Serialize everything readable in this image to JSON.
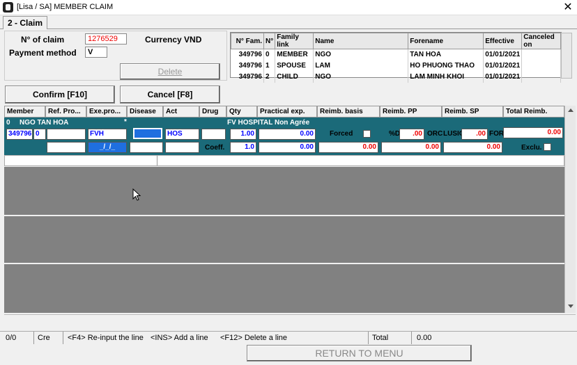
{
  "window": {
    "title": "[Lisa / SA] MEMBER CLAIM",
    "close_glyph": "✕"
  },
  "tab": {
    "label": "2 - Claim"
  },
  "form": {
    "claim_no_label": "N° of claim",
    "claim_no_value": "1276529",
    "currency_label": "Currency VND",
    "payment_method_label": "Payment method",
    "payment_method_value": "V"
  },
  "buttons": {
    "delete": "Delete",
    "confirm": "Confirm [F10]",
    "cancel": "Cancel [F8]",
    "return": "RETURN TO MENU"
  },
  "family_table": {
    "headers": [
      "N° Fam.",
      "N°",
      "Family link",
      "Name",
      "Forename",
      "Effective",
      "Canceled on"
    ],
    "rows": [
      [
        "349796",
        "0",
        "MEMBER",
        "NGO",
        "TAN HOA",
        "01/01/2021",
        ""
      ],
      [
        "349796",
        "1",
        "SPOUSE",
        "LAM",
        "HO PHUONG THAO",
        "01/01/2021",
        ""
      ],
      [
        "349796",
        "2",
        "CHILD",
        "NGO",
        "LAM MINH KHOI",
        "01/01/2021",
        ""
      ]
    ]
  },
  "claim_grid": {
    "headers": [
      "Member",
      "Ref. Pro...",
      "Exe.pro...",
      "Disease",
      "Act",
      "Drug",
      "Qty",
      "Practical exp.",
      "Reimb. basis",
      "Reimb. PP",
      "Reimb. SP",
      "Total Reimb."
    ],
    "line": {
      "row_index": "0",
      "member_name": "NGO TAN HOA",
      "marker": "*",
      "provider_name": "FV HOSPITAL Non Agrée",
      "member_no": "349796",
      "member_seq": "0",
      "exe_provider": "FVH",
      "act": "HOS",
      "qty": "1.00",
      "practical_exp": "0.00",
      "forced_label": "Forced",
      "pct_label": "%D",
      "pct_value": ".00",
      "forced_label2": "ORC",
      "excl_label": "LUSIO",
      "pp_value": ".00",
      "forced_label3": "FOR",
      "total_reimb": "0.00",
      "date_value": "_/_/_",
      "coeff_label": "Coeff.",
      "coeff_value": "1.0",
      "coeff_amount": "0.00",
      "basis_amount": "0.00",
      "pp_amount": "0.00",
      "sp_amount": "0.00",
      "exclu_label": "Exclu."
    }
  },
  "status_bar": {
    "counter": "0/0",
    "mode": "Cre",
    "hint1": "<F4> Re-input the line",
    "hint2": "<INS> Add a line",
    "hint3": "<F12> Delete a line",
    "total_label": "Total",
    "total_value": "0.00"
  }
}
